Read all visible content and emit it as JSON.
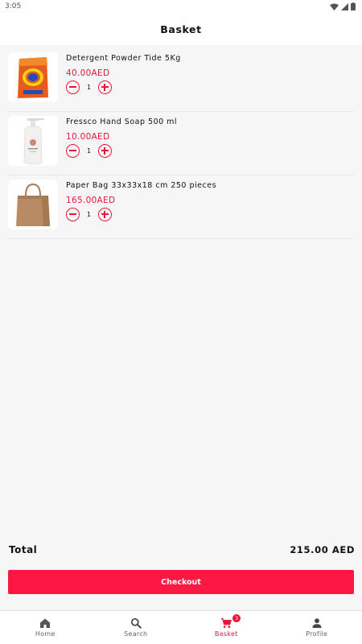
{
  "status_bar": {
    "time": "3:05"
  },
  "header": {
    "title": "Basket"
  },
  "cart": {
    "items": [
      {
        "name": "Detergent Powder Tide 5Kg",
        "price": "40.00AED",
        "quantity": "1",
        "image": "tide-detergent-pack"
      },
      {
        "name": "Fressco Hand Soap 500 ml",
        "price": "10.00AED",
        "quantity": "1",
        "image": "hand-soap-pump-bottle"
      },
      {
        "name": "Paper Bag 33x33x18 cm 250 pieces",
        "price": "165.00AED",
        "quantity": "1",
        "image": "brown-paper-bag"
      }
    ]
  },
  "summary": {
    "total_label": "Total",
    "total_value": "215.00 AED"
  },
  "checkout": {
    "label": "Checkout"
  },
  "bottom_nav": {
    "items": [
      {
        "label": "Home",
        "icon": "home-icon"
      },
      {
        "label": "Search",
        "icon": "search-icon"
      },
      {
        "label": "Basket",
        "icon": "cart-icon",
        "badge": "3",
        "active": true
      },
      {
        "label": "Profile",
        "icon": "person-icon"
      }
    ]
  },
  "colors": {
    "accent": "#e8173a",
    "checkout_bg": "#ff1744",
    "background": "#f6f6f6"
  }
}
